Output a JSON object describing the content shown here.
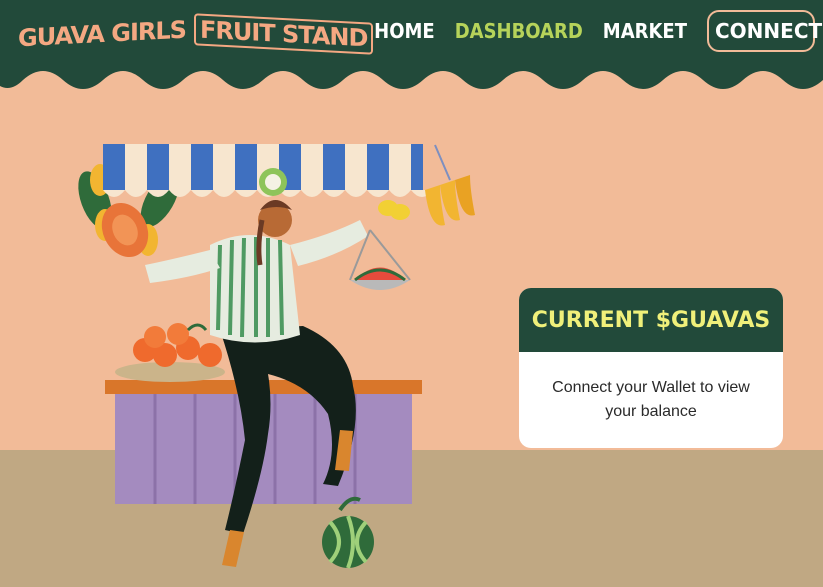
{
  "brand": {
    "logo_part1": "GUAVA GIRLS",
    "logo_part2": "FRUIT STAND",
    "colors": {
      "header": "#224a3a",
      "background": "#f2bb98",
      "ground": "#c0a883",
      "accent_nav": "#b6d35a",
      "logo": "#f4a882",
      "card_title": "#f0f07a"
    }
  },
  "nav": {
    "items": [
      {
        "label": "HOME",
        "active": false
      },
      {
        "label": "DASHBOARD",
        "active": true
      },
      {
        "label": "MARKET",
        "active": false
      }
    ],
    "connect_label": "CONNECT"
  },
  "balance_card": {
    "title": "CURRENT $GUAVAS",
    "message": "Connect your Wallet to view your balance"
  },
  "illustration": {
    "icons": [
      "awning-icon",
      "papaya-icon",
      "banana-icon",
      "watermelon-icon",
      "orange-icon",
      "guava-icon",
      "scale-icon",
      "lemon-icon"
    ]
  }
}
